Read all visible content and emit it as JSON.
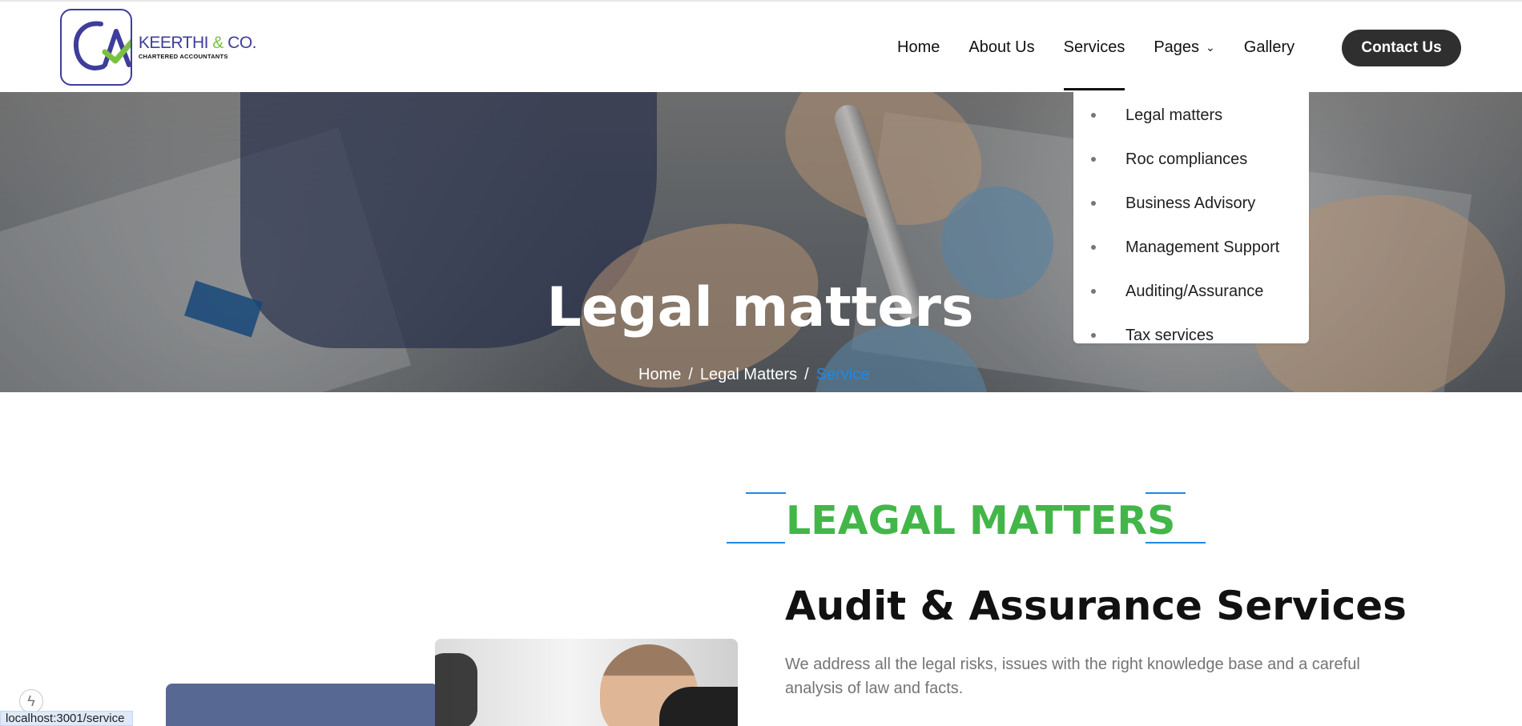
{
  "header": {
    "logo": {
      "mark": "CA",
      "company_main": "KEERTHI",
      "company_amp": "&",
      "company_end": "CO.",
      "company_subtitle": "CHARTERED ACCOUNTANTS"
    },
    "nav": {
      "home": "Home",
      "about": "About Us",
      "services": "Services",
      "pages": "Pages",
      "gallery": "Gallery"
    },
    "contact_button": "Contact Us"
  },
  "dropdown": {
    "items": [
      "Legal matters",
      "Roc compliances",
      "Business Advisory",
      "Management Support",
      "Auditing/Assurance",
      "Tax services"
    ]
  },
  "hero": {
    "title": "Legal matters",
    "breadcrumb": {
      "home": "Home",
      "sep": "/",
      "legal": "Legal Matters",
      "current": "Service"
    }
  },
  "content": {
    "section_title": "LEAGAL MATTERS",
    "heading": "Audit & Assurance Services",
    "description": "We address all the legal risks, issues with the right knowledge base and a careful analysis of law and facts."
  },
  "status_bar": {
    "url": "localhost:3001/service"
  },
  "colors": {
    "brand_blue": "#3f3d9b",
    "accent_green": "#43b649",
    "link_blue": "#1e88e5",
    "dark_button": "#2f2f2f"
  },
  "icons": {
    "logo": "ca-logo-icon",
    "pages_chevron": "chevron-down-icon",
    "lightning": "lightning-icon"
  }
}
